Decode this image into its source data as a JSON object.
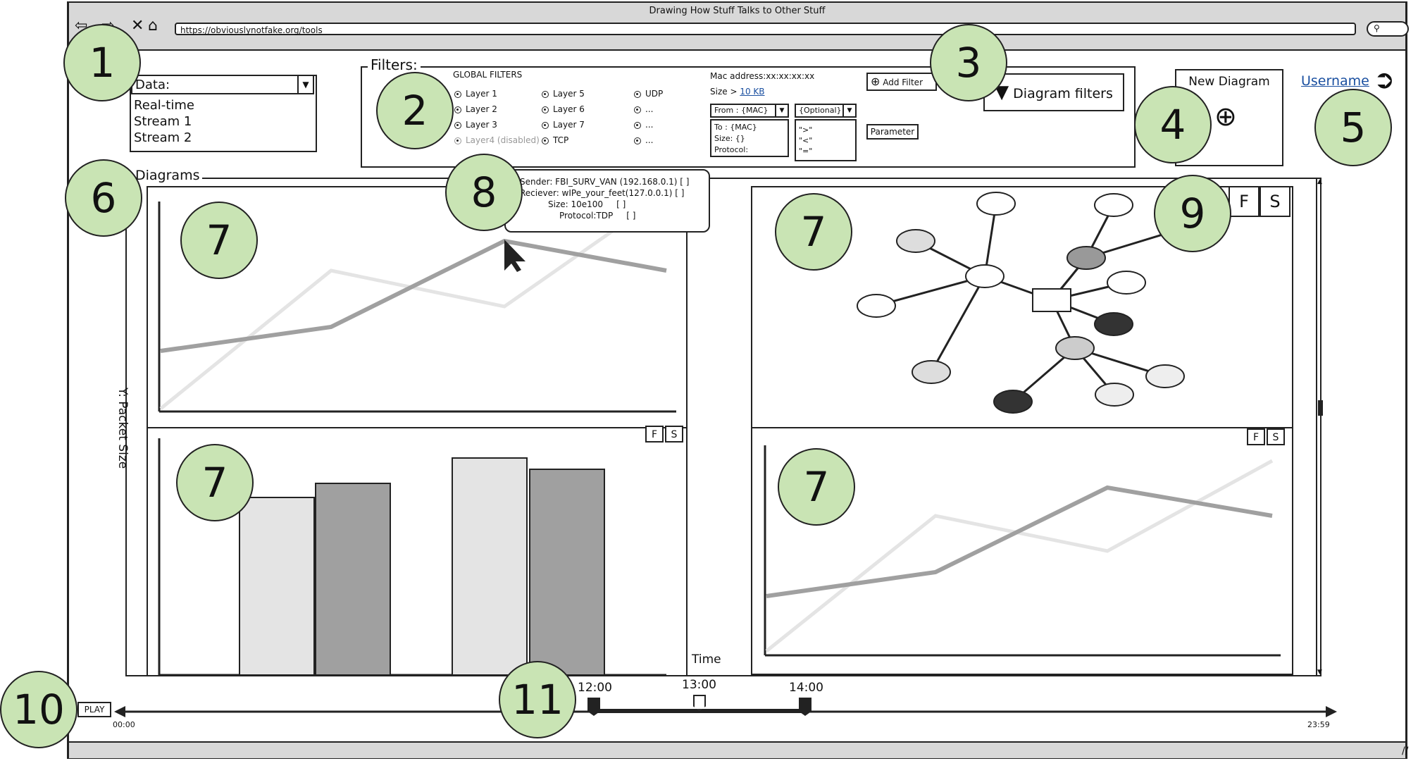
{
  "window": {
    "title": "Drawing How Stuff Talks to Other Stuff",
    "url": "https://obviouslynotfake.org/tools"
  },
  "data_panel": {
    "label": "Data:",
    "options": [
      "Real-time",
      "Stream 1",
      "Stream 2"
    ]
  },
  "filters": {
    "label": "Filters:",
    "global_title": "GLOBAL FILTERS",
    "col1": [
      "Layer 1",
      "Layer 2",
      "Layer 3",
      "Layer4 (disabled)"
    ],
    "col2": [
      "Layer 5",
      "Layer 6",
      "Layer 7",
      "TCP"
    ],
    "col3": [
      "UDP",
      "...",
      "...",
      "..."
    ],
    "mac_label": "Mac address:xx:xx:xx:xx",
    "size_prefix": "Size >",
    "size_link": "10 KB",
    "from_select": "From : {MAC}",
    "from_list": [
      "To : {MAC}",
      "Size: {}",
      "Protocol:"
    ],
    "optional_select": "{Optional}",
    "optional_list": [
      "\">\"",
      "\"<\"",
      "\"=\""
    ],
    "add_filter": "Add Filter",
    "parameter": "Parameter"
  },
  "diagram_filters_button": "Diagram filters",
  "new_diagram": {
    "label": "New Diagram"
  },
  "user": {
    "name": "Username"
  },
  "diagrams": {
    "label": "Diagrams",
    "ylabel": "Y: Packet Size",
    "xlabel": "Time"
  },
  "tooltip": {
    "sender": "Sender: FBI_SURV_VAN (192.168.0.1) [  ]",
    "receiver": "Reciever: wIPe_your_feet(127.0.0.1) [  ]",
    "size": "Size: 10e100",
    "size_box": "[  ]",
    "protocol": "Protocol:TDP",
    "protocol_box": "[  ]"
  },
  "fs": {
    "f": "F",
    "s": "S"
  },
  "timeline": {
    "play": "PLAY",
    "start": "00:00",
    "end": "23:59",
    "marks": [
      "12:00",
      "13:00",
      "14:00"
    ]
  },
  "callouts": [
    "1",
    "2",
    "3",
    "4",
    "5",
    "6",
    "7",
    "8",
    "9",
    "10",
    "11"
  ],
  "colors": {
    "callout_fill": "#c9e4b4",
    "dark_series": "#a0a0a0",
    "light_series": "#e4e4e4"
  }
}
